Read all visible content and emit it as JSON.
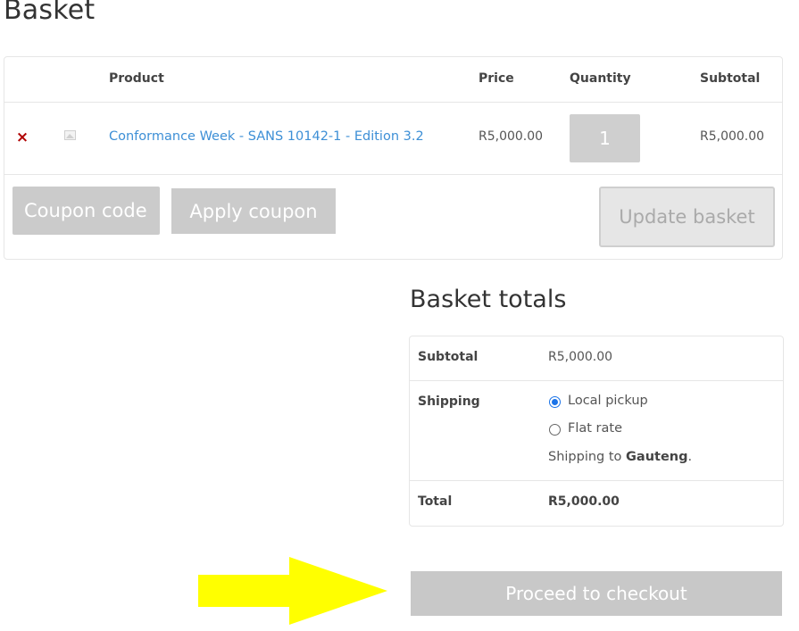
{
  "page": {
    "title": "Basket"
  },
  "cart": {
    "headers": {
      "product": "Product",
      "price": "Price",
      "quantity": "Quantity",
      "subtotal": "Subtotal"
    },
    "items": [
      {
        "remove_label": "×",
        "name": "Conformance Week - SANS 10142-1 - Edition 3.2",
        "price": "R5,000.00",
        "quantity": "1",
        "subtotal": "R5,000.00"
      }
    ],
    "coupon_placeholder": "Coupon code",
    "apply_coupon_label": "Apply coupon",
    "update_basket_label": "Update basket"
  },
  "totals": {
    "title": "Basket totals",
    "subtotal_label": "Subtotal",
    "subtotal_value": "R5,000.00",
    "shipping_label": "Shipping",
    "shipping_options": [
      {
        "label": "Local pickup",
        "selected": true
      },
      {
        "label": "Flat rate",
        "selected": false
      }
    ],
    "shipping_to_prefix": "Shipping to ",
    "shipping_to_region": "Gauteng",
    "shipping_to_suffix": ".",
    "total_label": "Total",
    "total_value": "R5,000.00"
  },
  "checkout": {
    "label": "Proceed to checkout"
  },
  "colors": {
    "link": "#3d8fd6",
    "remove": "#b00000",
    "button_gray": "#c8c8c8",
    "radio_selected": "#1a73e8",
    "arrow": "#ffff00"
  },
  "icons": {
    "remove": "close-icon",
    "thumbnail": "image-placeholder-icon",
    "annotation": "arrow-right-icon"
  }
}
